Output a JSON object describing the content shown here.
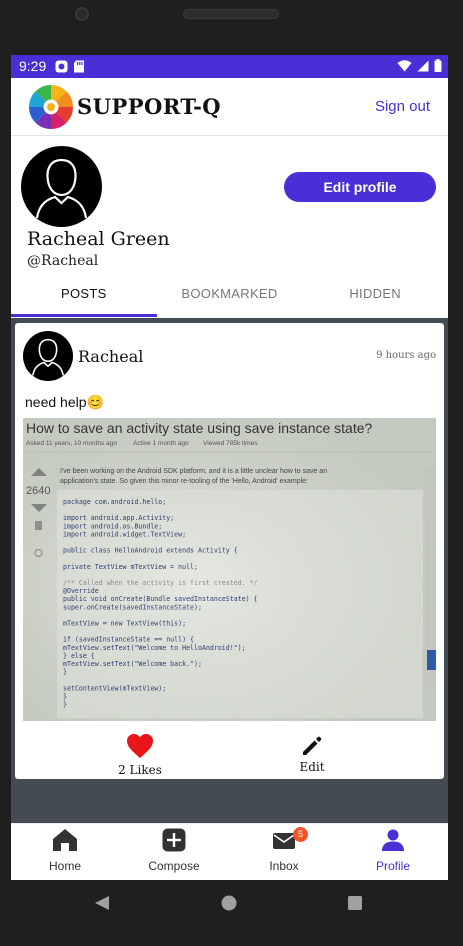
{
  "status_bar": {
    "time": "9:29"
  },
  "app_bar": {
    "brand": "SUPPORT-Q",
    "sign_out_label": "Sign out"
  },
  "profile": {
    "name": "Racheal Green",
    "handle": "@Racheal",
    "edit_label": "Edit profile"
  },
  "tabs": [
    {
      "label": "POSTS",
      "active": true
    },
    {
      "label": "BOOKMARKED",
      "active": false
    },
    {
      "label": "HIDDEN",
      "active": false
    }
  ],
  "post": {
    "author": "Racheal",
    "time_ago": "9 hours ago",
    "text": "need help😊",
    "likes_label": "2 Likes",
    "edit_label": "Edit",
    "image": {
      "title": "How to save an activity state using save instance state?",
      "meta_asked": "Asked 11 years, 10 months ago",
      "meta_active": "Active 1 month ago",
      "meta_viewed": "Viewed 785k times",
      "votes": "2640",
      "intro_line1": "I've been working on the Android SDK platform, and it is a little unclear how to save an",
      "intro_line2": "application's state. So given this minor re-tooling of the 'Hello, Android' example:",
      "code": [
        "package com.android.hello;",
        "",
        "import android.app.Activity;",
        "import android.os.Bundle;",
        "import android.widget.TextView;",
        "",
        "public class HelloAndroid extends Activity {",
        "",
        "  private TextView mTextView = null;",
        "",
        "  /** Called when the activity is first created. */",
        "  @Override",
        "  public void onCreate(Bundle savedInstanceState) {",
        "    super.onCreate(savedInstanceState);",
        "",
        "    mTextView = new TextView(this);",
        "",
        "    if (savedInstanceState == null) {",
        "      mTextView.setText(\"Welcome to HelloAndroid!\");",
        "    } else {",
        "      mTextView.setText(\"Welcome back.\");",
        "    }",
        "",
        "    setContentView(mTextView);",
        "  }",
        "}"
      ]
    }
  },
  "bottom_nav": [
    {
      "label": "Home",
      "icon": "home-icon",
      "active": false
    },
    {
      "label": "Compose",
      "icon": "compose-icon",
      "active": false
    },
    {
      "label": "Inbox",
      "icon": "inbox-icon",
      "active": false,
      "badge": "5"
    },
    {
      "label": "Profile",
      "icon": "profile-icon",
      "active": true
    }
  ],
  "colors": {
    "accent": "#4a2fd6",
    "status_bar": "#4a2fd6",
    "feed_background": "#454b52",
    "like": "#e8151b",
    "badge": "#f3542a"
  }
}
